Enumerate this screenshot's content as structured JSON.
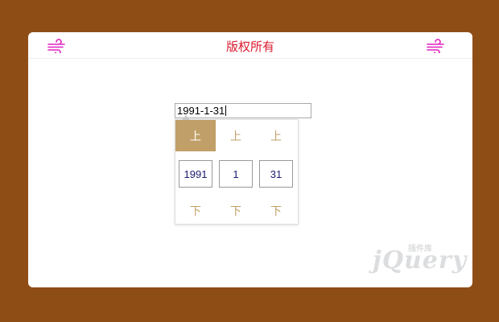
{
  "header": {
    "title": "版权所有",
    "left_icon": "wind-icon",
    "right_icon": "wind-icon",
    "icon_color": "#e020c0"
  },
  "date_input": {
    "value": "1991-1-31"
  },
  "picker": {
    "up_labels": [
      "上",
      "上",
      "上"
    ],
    "values": [
      "1991",
      "1",
      "31"
    ],
    "down_labels": [
      "下",
      "下",
      "下"
    ],
    "active_up_index": 0,
    "accent_color": "#c19f68"
  },
  "watermark": {
    "word": "jQuery",
    "cn": "插件库"
  },
  "colors": {
    "background": "#8f4d16",
    "title": "#dd1a2e"
  }
}
